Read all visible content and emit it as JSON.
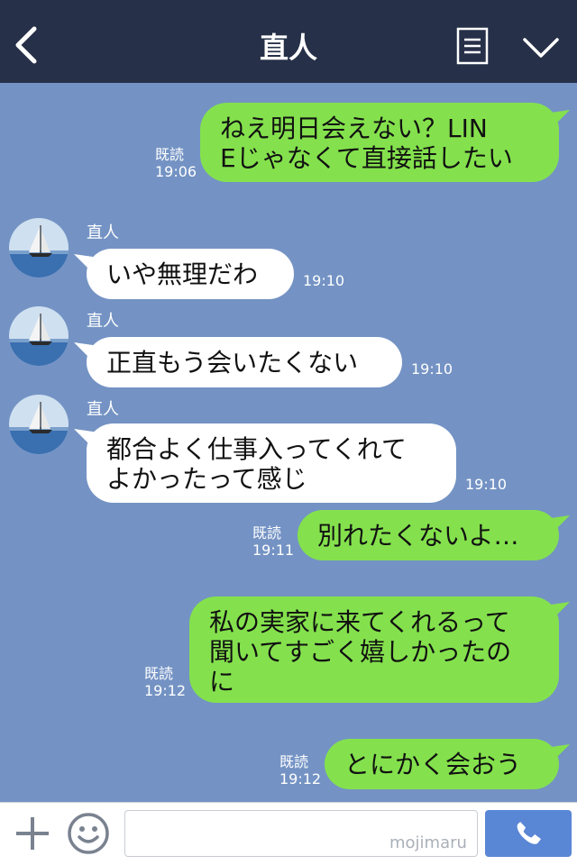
{
  "header": {
    "title": "直人"
  },
  "messages": [
    {
      "side": "right",
      "lines": [
        "ねえ明日会えない？LIN",
        "Eじゃなくて直接話したい"
      ],
      "read": "既読",
      "time": "19:06"
    },
    {
      "side": "left",
      "sender": "直人",
      "lines": [
        "いや無理だわ"
      ],
      "time": "19:10"
    },
    {
      "side": "left",
      "sender": "直人",
      "lines": [
        "正直もう会いたくない"
      ],
      "time": "19:10"
    },
    {
      "side": "left",
      "sender": "直人",
      "lines": [
        "都合よく仕事入ってくれて",
        "よかったって感じ"
      ],
      "time": "19:10"
    },
    {
      "side": "right",
      "lines": [
        "別れたくないよ…"
      ],
      "read": "既読",
      "time": "19:11"
    },
    {
      "side": "right",
      "lines": [
        "私の実家に来てくれるって",
        "聞いてすごく嬉しかったの",
        "に"
      ],
      "read": "既読",
      "time": "19:12"
    },
    {
      "side": "right",
      "lines": [
        "とにかく会おう"
      ],
      "read": "既読",
      "time": "19:12"
    }
  ],
  "footer": {
    "input_value": "",
    "watermark": "mojimaru"
  },
  "icons": {
    "back": "chevron-left-icon",
    "menu": "menu-list-icon",
    "collapse": "chevron-down-icon",
    "add": "plus-icon",
    "emoji": "smiley-icon",
    "call": "phone-icon"
  },
  "colors": {
    "header_bg": "#263048",
    "chat_bg": "#7493c4",
    "bubble_sent": "#84e14d",
    "bubble_received": "#ffffff",
    "call_button": "#5a86d6"
  }
}
